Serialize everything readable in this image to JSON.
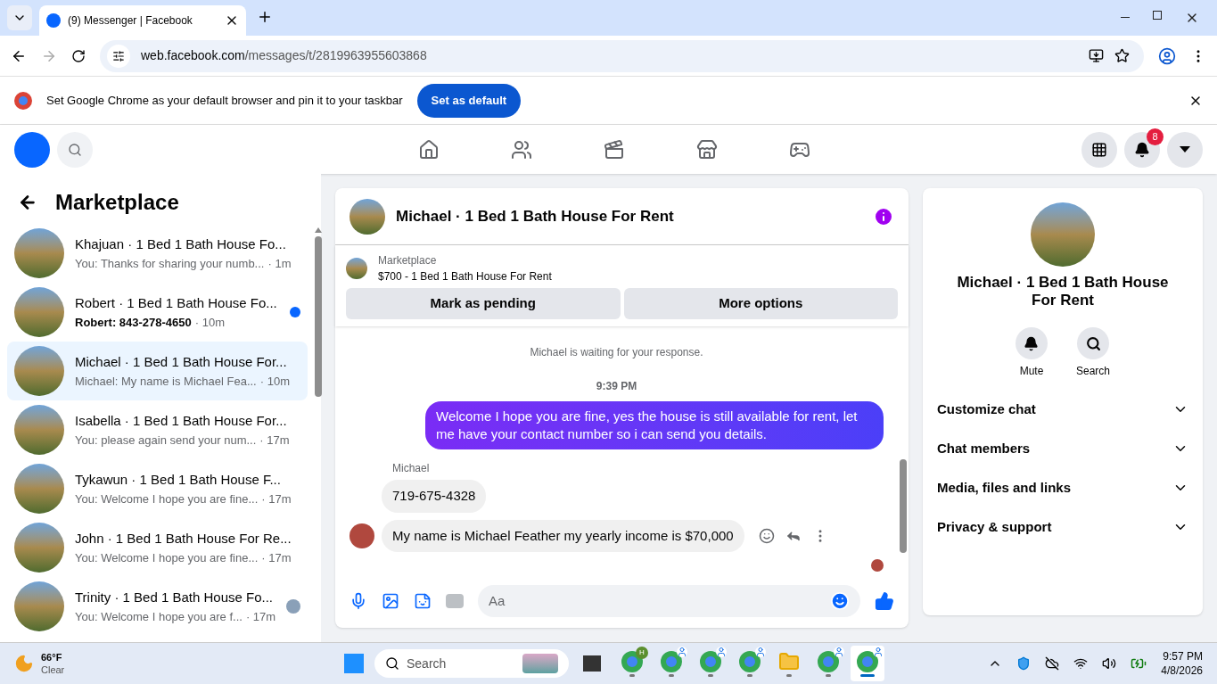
{
  "browser": {
    "tab_title": "(9) Messenger | Facebook",
    "url_host": "web.facebook.com",
    "url_path": "/messages/t/2819963955603868",
    "infobar_text": "Set Google Chrome as your default browser and pin it to your taskbar",
    "infobar_button": "Set as default"
  },
  "facebook_header": {
    "notification_count": "8",
    "nav": [
      {
        "kind": "home",
        "selected": false
      },
      {
        "kind": "friends",
        "selected": false
      },
      {
        "kind": "video",
        "selected": false
      },
      {
        "kind": "marketplace",
        "selected": false
      },
      {
        "kind": "gaming",
        "selected": false
      }
    ]
  },
  "sidebar": {
    "title": "Marketplace",
    "chats": [
      {
        "title": "Khajuan · 1 Bed 1 Bath House Fo...",
        "preview": "You: Thanks for sharing your numb...",
        "time": "· 1m",
        "selected": false,
        "unread": false,
        "seen": false
      },
      {
        "title": "Robert · 1 Bed 1 Bath House Fo...",
        "preview": "Robert: 843-278-4650",
        "time": "· 10m",
        "selected": false,
        "unread": true,
        "seen": false
      },
      {
        "title": "Michael · 1 Bed 1 Bath House For...",
        "preview": "Michael: My name is Michael Fea...",
        "time": "· 10m",
        "selected": true,
        "unread": false,
        "seen": false
      },
      {
        "title": "Isabella · 1 Bed 1 Bath House For...",
        "preview": "You: please again send your num...",
        "time": "· 17m",
        "selected": false,
        "unread": false,
        "seen": false
      },
      {
        "title": "Tykawun · 1 Bed 1 Bath House F...",
        "preview": "You: Welcome I hope you are fine...",
        "time": "· 17m",
        "selected": false,
        "unread": false,
        "seen": false
      },
      {
        "title": "John · 1 Bed 1 Bath House For Re...",
        "preview": "You: Welcome I hope you are fine...",
        "time": "· 17m",
        "selected": false,
        "unread": false,
        "seen": false
      },
      {
        "title": "Trinity · 1 Bed 1 Bath House Fo...",
        "preview": "You: Welcome I hope you are f...",
        "time": "· 17m",
        "selected": false,
        "unread": false,
        "seen": true
      }
    ]
  },
  "chat": {
    "title": "Michael · 1 Bed 1 Bath House For Rent",
    "listing_source": "Marketplace",
    "listing_title": "$700 - 1 Bed 1 Bath House For Rent",
    "actions": [
      "Mark as pending",
      "More options"
    ],
    "notice": "Michael is waiting for your response.",
    "timestamp": "9:39 PM",
    "messages": [
      {
        "kind": "sent",
        "text": "Welcome I hope you are fine, yes the house is still available for rent, let me have your contact number so i can send you  details."
      },
      {
        "kind": "sender_name",
        "text": "Michael"
      },
      {
        "kind": "received",
        "text": "719-675-4328",
        "avatar": false
      },
      {
        "kind": "received",
        "text": "My name is Michael Feather my yearly income is $70,000",
        "avatar": true
      }
    ],
    "composer_placeholder": "Aa"
  },
  "info_panel": {
    "title": "Michael · 1 Bed 1 Bath House For Rent",
    "actions": [
      {
        "kind": "mute",
        "label": "Mute"
      },
      {
        "kind": "search",
        "label": "Search"
      }
    ],
    "sections": [
      {
        "label": "Customize chat",
        "expanded": false
      },
      {
        "label": "Chat members",
        "expanded": false
      },
      {
        "label": "Media, files and links",
        "expanded": false
      },
      {
        "label": "Privacy & support",
        "expanded": false
      }
    ]
  },
  "taskbar": {
    "temperature": "66°F",
    "condition": "Clear",
    "search_placeholder": "Search",
    "apps": [
      {
        "kind": "chrome",
        "badge": "H",
        "active": false
      },
      {
        "kind": "chrome",
        "active": false
      },
      {
        "kind": "chrome",
        "active": false
      },
      {
        "kind": "chrome",
        "active": false
      },
      {
        "kind": "folder",
        "active": false
      },
      {
        "kind": "chrome",
        "active": false
      },
      {
        "kind": "chrome",
        "active": true
      }
    ],
    "time": "9:57 PM",
    "date": "4/8/2026"
  }
}
